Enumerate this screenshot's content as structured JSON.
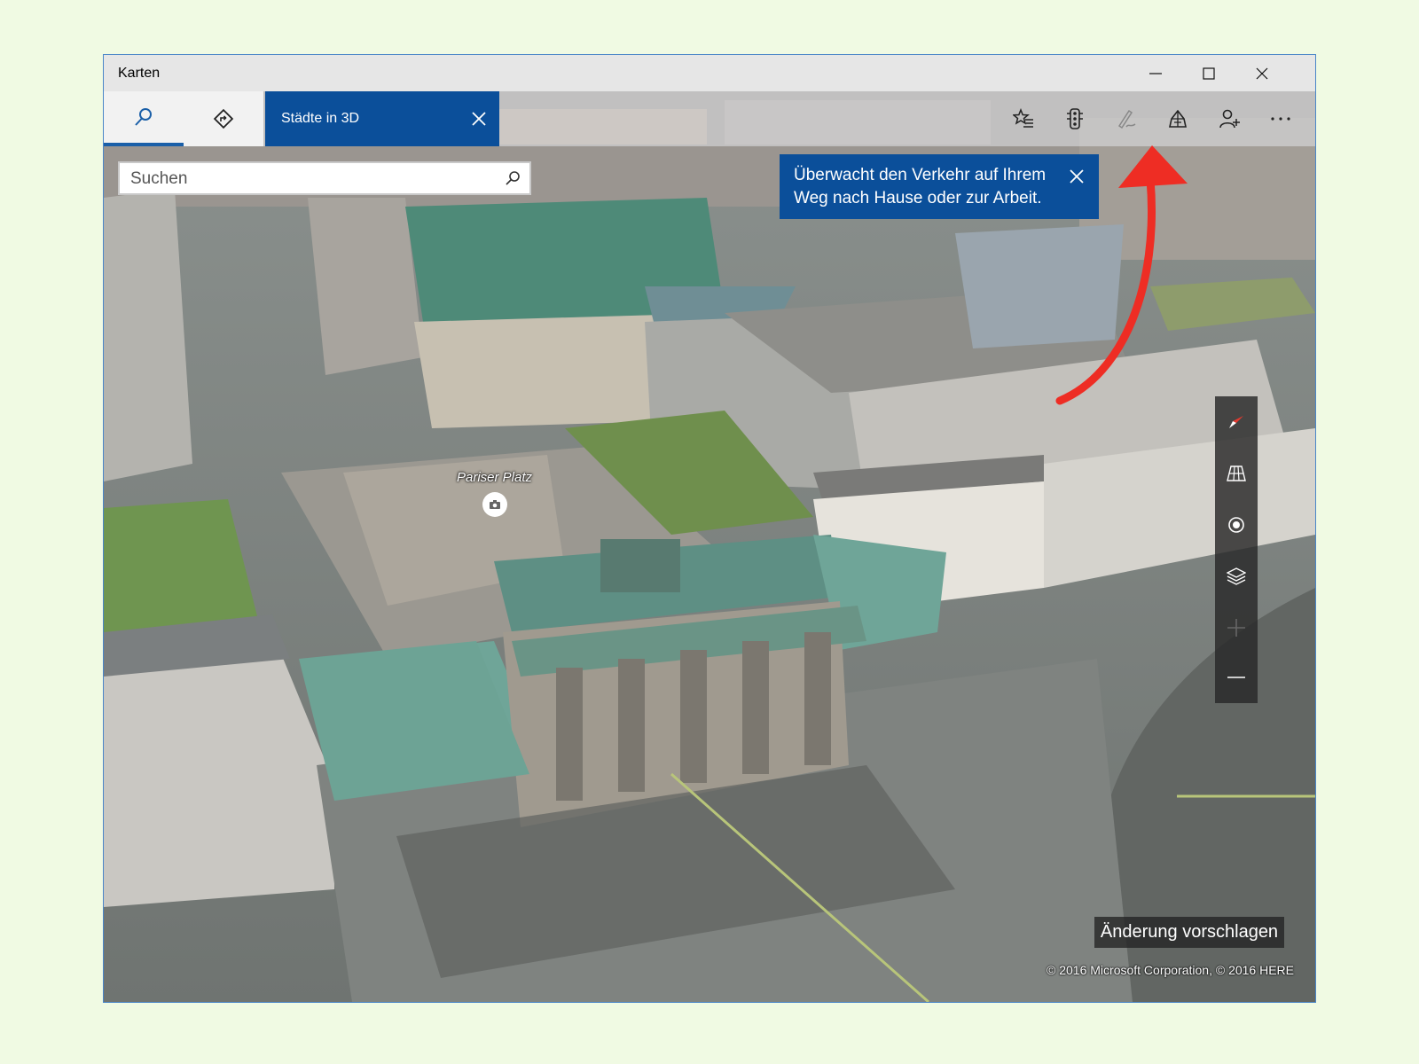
{
  "window": {
    "title": "Karten",
    "controls": [
      "minimize",
      "maximize",
      "close"
    ]
  },
  "toolbar": {
    "search_icon": "search-icon",
    "directions_icon": "directions-icon",
    "tab_label": "Städte in 3D",
    "right_icons": [
      "favorites-icon",
      "traffic-icon",
      "ink-icon",
      "3d-cities-icon",
      "sign-in-icon",
      "more-icon"
    ]
  },
  "search": {
    "placeholder": "Suchen",
    "value": ""
  },
  "tooltip": {
    "text": "Überwacht den Verkehr auf Ihrem Weg nach Hause oder zur Arbeit."
  },
  "map": {
    "poi_label": "Pariser Platz",
    "controls": [
      "compass-icon",
      "tilt-icon",
      "location-icon",
      "layers-icon",
      "zoom-in-icon",
      "zoom-out-icon"
    ],
    "suggest_label": "Änderung vorschlagen",
    "copyright": "© 2016 Microsoft Corporation, © 2016 HERE"
  },
  "colors": {
    "accent": "#0b4f9a",
    "annotation_arrow": "#ee2d24",
    "page_background": "#f0fae3"
  }
}
